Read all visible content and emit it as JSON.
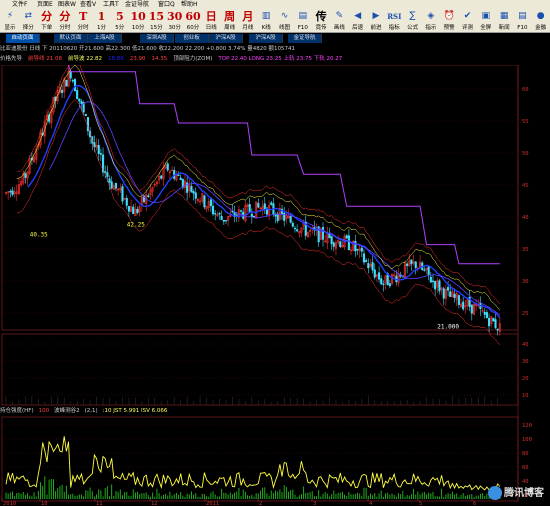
{
  "menu": [
    "文件F",
    "页面E",
    "图表W",
    "查看V",
    "工具T",
    "金证导航",
    "窗口Q",
    "帮助H"
  ],
  "toolbar": [
    {
      "big": "",
      "small": "显示",
      "icon": "lightning-icon"
    },
    {
      "big": "",
      "small": "择分",
      "icon": "swap-icon"
    },
    {
      "big": "分",
      "small": "下单"
    },
    {
      "big": "分",
      "small": "分时"
    },
    {
      "big": "T",
      "small": "分时"
    },
    {
      "big": "1",
      "small": "1分"
    },
    {
      "big": "5",
      "small": "5分"
    },
    {
      "big": "10",
      "small": "10分"
    },
    {
      "big": "15",
      "small": "15分"
    },
    {
      "big": "30",
      "small": "30分"
    },
    {
      "big": "60",
      "small": "60分"
    },
    {
      "big": "日",
      "small": "日线"
    },
    {
      "big": "周",
      "small": "周线"
    },
    {
      "big": "月",
      "small": "月线"
    },
    {
      "big": "",
      "small": "K线",
      "icon": "kline-icon"
    },
    {
      "big": "",
      "small": "线图",
      "icon": "line-icon"
    },
    {
      "big": "",
      "small": "F10",
      "icon": "f10-icon"
    },
    {
      "big": "传",
      "small": "竟传"
    },
    {
      "big": "",
      "small": "画线",
      "icon": "pencil-icon"
    },
    {
      "big": "",
      "small": "后退",
      "icon": "back-icon"
    },
    {
      "big": "",
      "small": "前进",
      "icon": "forward-icon"
    },
    {
      "big": "RSI",
      "small": "指标"
    },
    {
      "big": "",
      "small": "公式",
      "icon": "formula-icon"
    },
    {
      "big": "",
      "small": "指示",
      "icon": "indicator-icon"
    },
    {
      "big": "",
      "small": "预警",
      "icon": "alarm-icon"
    },
    {
      "big": "",
      "small": "评测",
      "icon": "evaluate-icon"
    },
    {
      "big": "",
      "small": "全屏",
      "icon": "fullscreen-icon"
    },
    {
      "big": "",
      "small": "新闻",
      "icon": "news-icon"
    },
    {
      "big": "",
      "small": "F10",
      "icon": "f10b-icon"
    },
    {
      "big": "",
      "small": "金融",
      "icon": "finance-icon"
    }
  ],
  "tabs": [
    "自动页面",
    "默认页面",
    "上海A股",
    "深圳A股",
    "创业板",
    "沪深A股",
    "沪深A股",
    "金证导航"
  ],
  "stock_info": "比亚迪股份  日线  下 20110620  开21.600 高22.300 低21.600 收22.200 22.200 +0.800 3.74% 量4820 额105741",
  "indicators": [
    {
      "text": "价格先导",
      "color": "#cccccc"
    },
    {
      "text": "前导线 21.08",
      "color": "#ff4040"
    },
    {
      "text": "前导波 22.82",
      "color": "#ffff60"
    },
    {
      "text": "18.80",
      "color": "#2020ff"
    },
    {
      "text": "23.90",
      "color": "#ff4040"
    },
    {
      "text": "14.35",
      "color": "#ff4040"
    },
    {
      "text": "顶部阻力(ZOM)",
      "color": "#cccccc"
    },
    {
      "text": "TOP 22.40 LONG 23.25 上轨 23.75 下轨 20.27",
      "color": "#ff40ff"
    }
  ],
  "annotations": {
    "high": "64.700",
    "low1": "40.35",
    "low2": "42.25",
    "low3": "21.000"
  },
  "sub_indicator": [
    {
      "text": "持仓强度(HF)",
      "color": "#cccccc"
    },
    {
      "text": "100",
      "color": "#ff4040"
    },
    {
      "text": "波峰测谷2",
      "color": "#cccccc"
    },
    {
      "text": "(2,1)",
      "color": "#cccccc"
    },
    {
      "text": ":10 JST 5.991 ISV 6.066",
      "color": "#ffff60"
    }
  ],
  "x_labels": [
    "2010",
    "10",
    "11",
    "12",
    "2011",
    "2",
    "3",
    "4",
    "5",
    "6"
  ],
  "main_axis": [
    "60",
    "55",
    "50",
    "45",
    "40",
    "35",
    "30",
    "25"
  ],
  "mid_axis": [
    "40",
    "30",
    "20",
    "10"
  ],
  "bottom_axis": [
    "120",
    "100",
    "80",
    "60",
    "40",
    "20"
  ],
  "watermark": "腾讯博客",
  "colors": {
    "up": "#ff3030",
    "down": "#40e0ff",
    "ma_blue": "#2040ff",
    "ma_purple": "#b040ff",
    "yellow": "#ffff40",
    "grid": "#802020"
  }
}
